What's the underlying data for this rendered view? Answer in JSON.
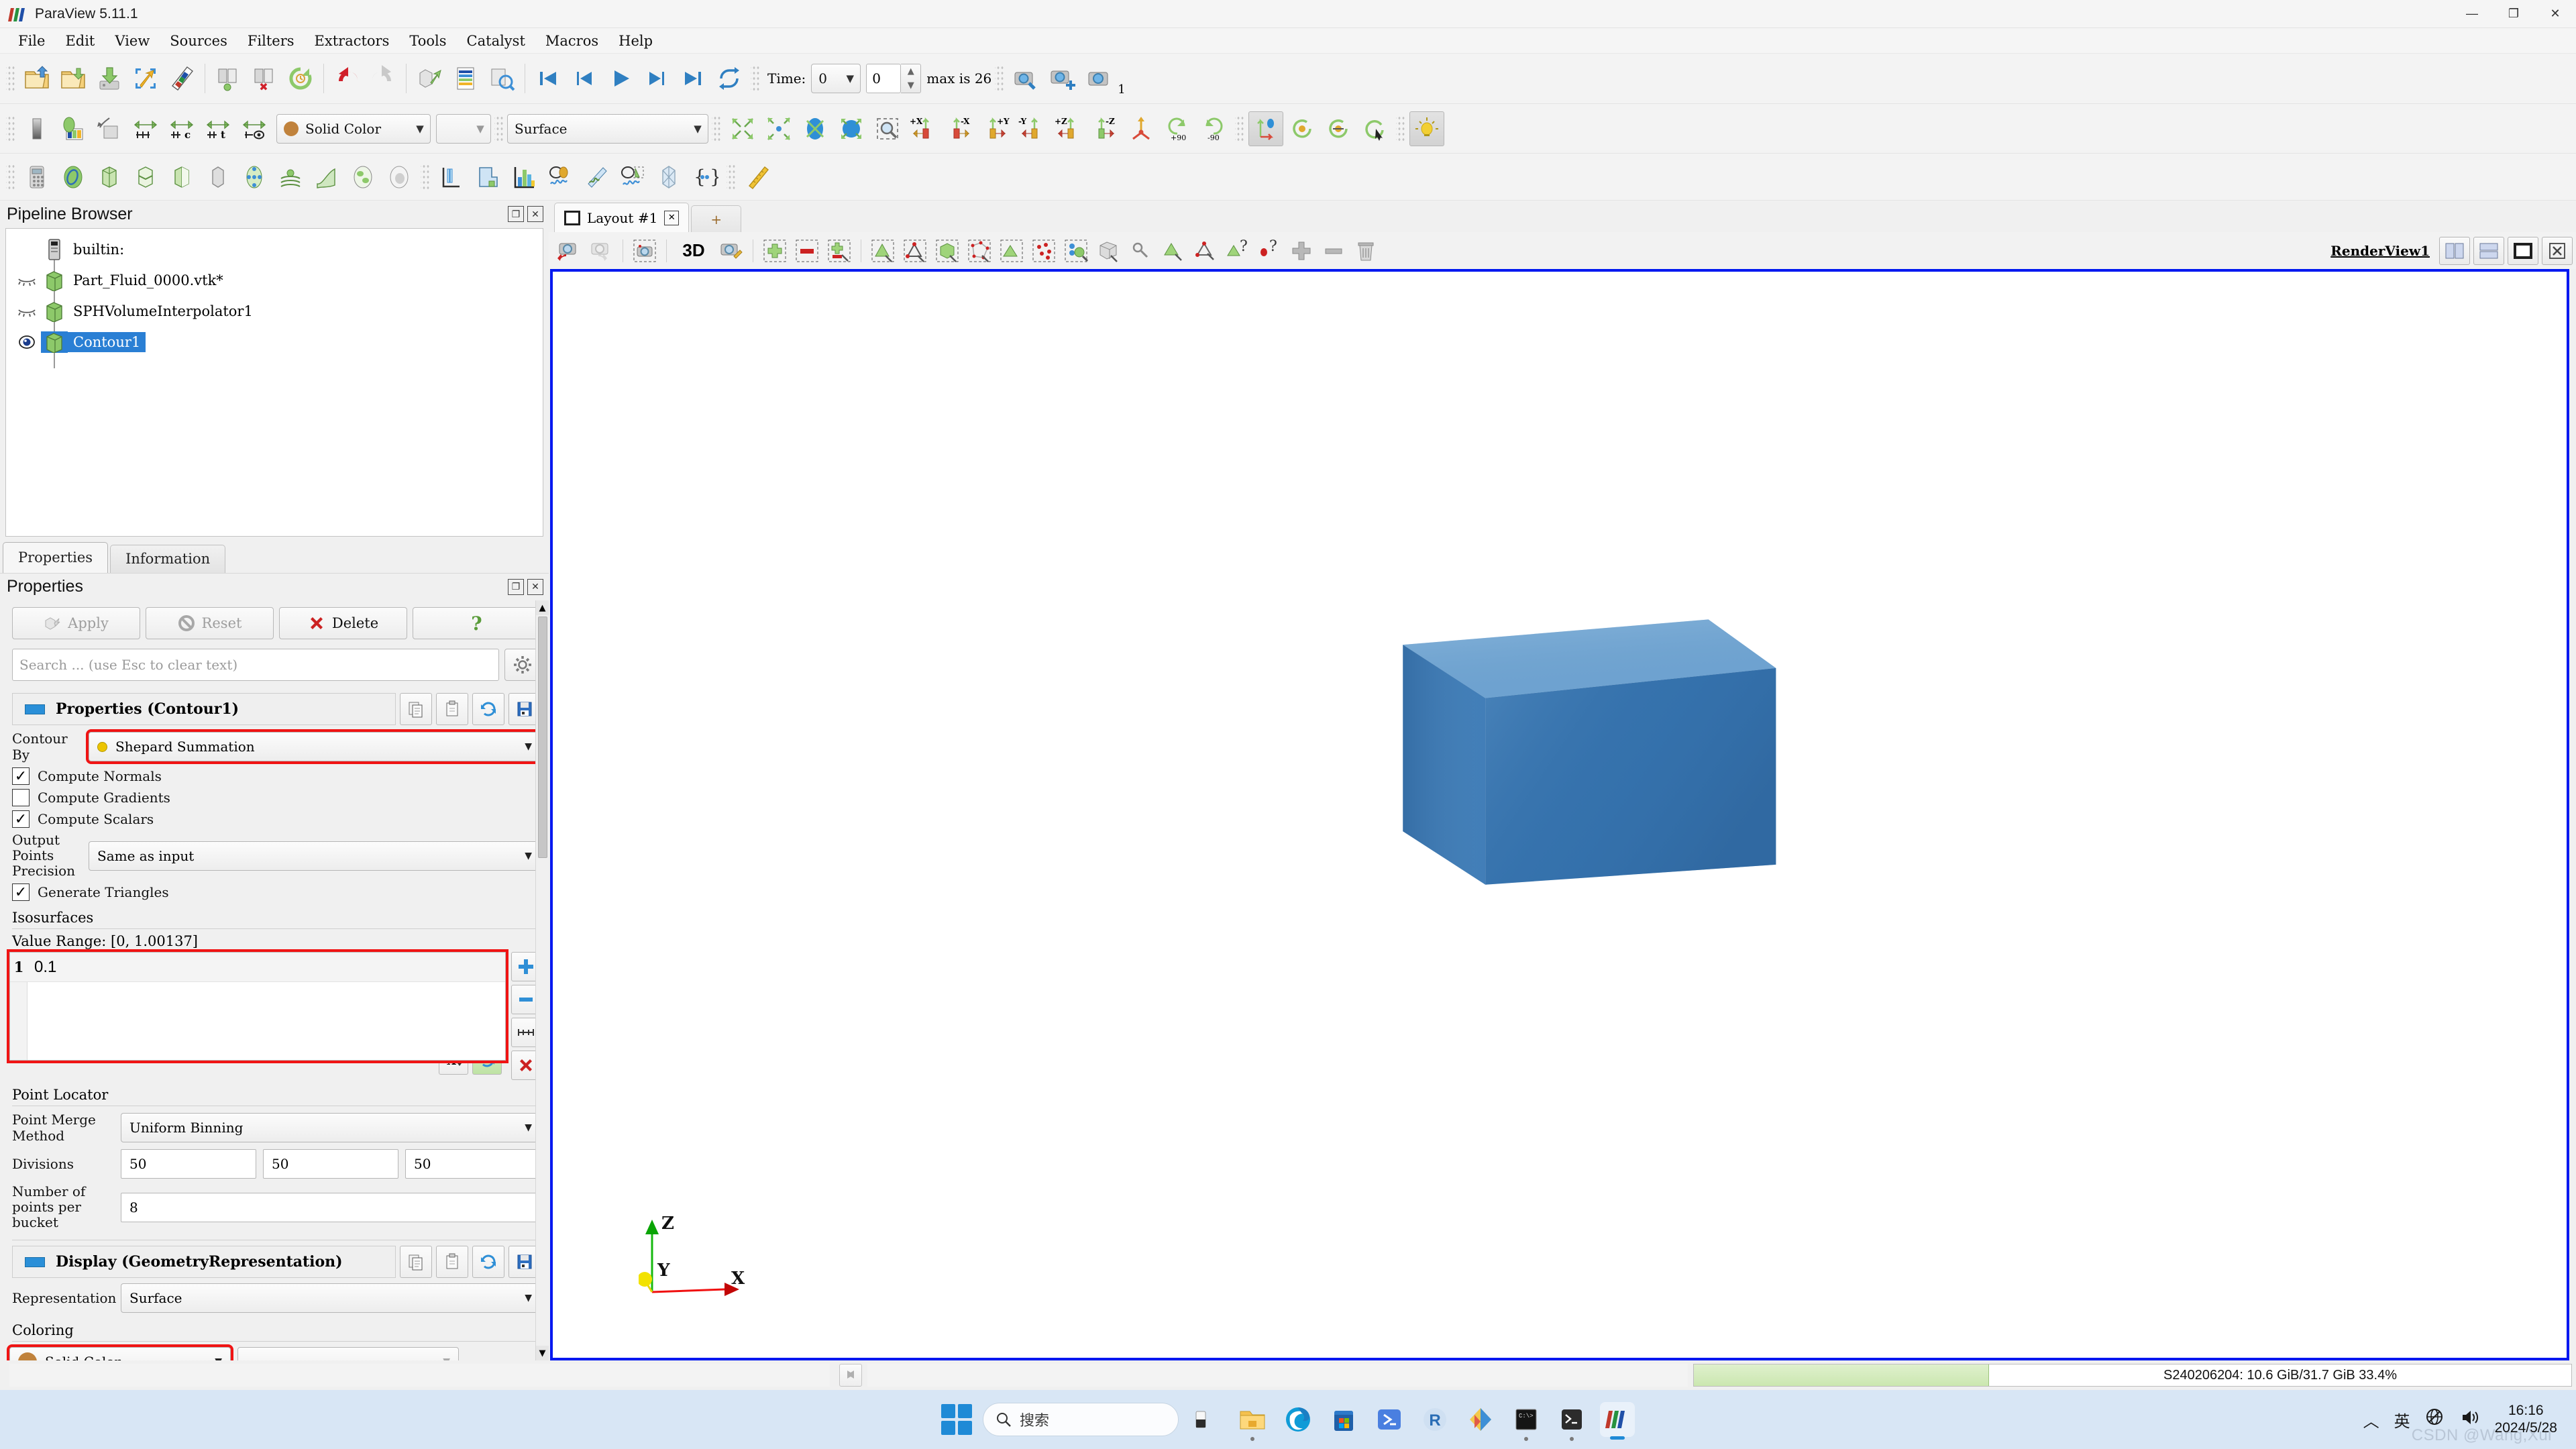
{
  "window": {
    "title": "ParaView 5.11.1",
    "minimize": "—",
    "maximize": "❐",
    "close": "✕"
  },
  "menu": {
    "items": [
      {
        "label": "File"
      },
      {
        "label": "Edit"
      },
      {
        "label": "View"
      },
      {
        "label": "Sources"
      },
      {
        "label": "Filters"
      },
      {
        "label": "Extractors"
      },
      {
        "label": "Tools"
      },
      {
        "label": "Catalyst"
      },
      {
        "label": "Macros"
      },
      {
        "label": "Help"
      }
    ]
  },
  "toolbar_main": {
    "time_label": "Time:",
    "time_value": "0",
    "frame_value": "0",
    "max_label": "max is 26",
    "screenshot_count": "1"
  },
  "toolbar_display": {
    "color_by": "Solid Color",
    "color_by_secondary": "",
    "representation": "Surface"
  },
  "pipeline": {
    "title": "Pipeline Browser",
    "items": [
      {
        "label": "builtin:",
        "type": "server",
        "visible": null,
        "selected": false
      },
      {
        "label": "Part_Fluid_0000.vtk*",
        "type": "source",
        "visible": false,
        "selected": false
      },
      {
        "label": "SPHVolumeInterpolator1",
        "type": "source",
        "visible": false,
        "selected": false
      },
      {
        "label": "Contour1",
        "type": "source",
        "visible": true,
        "selected": true
      }
    ]
  },
  "tabs": {
    "properties": "Properties",
    "information": "Information"
  },
  "properties": {
    "title": "Properties",
    "apply_label": "Apply",
    "reset_label": "Reset",
    "delete_label": "Delete",
    "help_label": "?",
    "search_placeholder": "Search ... (use Esc to clear text)",
    "section_properties": "Properties (Contour1)",
    "contour_by_label": "Contour By",
    "contour_by_value": "Shepard Summation",
    "compute_normals": {
      "label": "Compute Normals",
      "checked": true
    },
    "compute_gradients": {
      "label": "Compute Gradients",
      "checked": false
    },
    "compute_scalars": {
      "label": "Compute Scalars",
      "checked": true
    },
    "output_points_precision_label": "Output Points Precision",
    "output_points_precision_value": "Same as input",
    "generate_triangles": {
      "label": "Generate Triangles",
      "checked": true
    },
    "isosurfaces_label": "Isosurfaces",
    "value_range_label": "Value Range: [0, 1.00137]",
    "isosurface_rows": [
      {
        "index": "1",
        "value": "0.1"
      }
    ],
    "point_locator_label": "Point Locator",
    "point_merge_method_label": "Point Merge Method",
    "point_merge_method_value": "Uniform Binning",
    "divisions_label": "Divisions",
    "divisions": [
      "50",
      "50",
      "50"
    ],
    "points_per_bucket_label": "Number of points per bucket",
    "points_per_bucket_value": "8",
    "section_display": "Display (GeometryRepresentation)",
    "representation_label": "Representation",
    "representation_value": "Surface",
    "coloring_label": "Coloring",
    "coloring_value": "Solid Color",
    "coloring_secondary": ""
  },
  "layout": {
    "tab_label": "Layout #1",
    "tab_close": "✕",
    "new_tab": "+",
    "mode_3d": "3D",
    "view_name": "RenderView1"
  },
  "render": {
    "axis_x": "X",
    "axis_y": "Y",
    "axis_z": "Z",
    "box_color_top": "#5a92c8",
    "box_color_front": "#3b74b4",
    "box_color_side": "#2f66a4"
  },
  "statusbar": {
    "message": "",
    "memory": "S240206204: 10.6 GiB/31.7 GiB 33.4%",
    "memory_percent": 33.4
  },
  "taskbar": {
    "search_placeholder": "搜索",
    "tray_chevron": "︿",
    "tray_ime": "英",
    "time": "16:16",
    "date": "2024/5/28",
    "watermark": "CSDN @Wang,Xui"
  },
  "colors": {
    "accent_blue": "#2a7fd4",
    "highlight_red": "#f01414",
    "view_border": "#0018f0",
    "solid_color_swatch": "#c0823c",
    "array_dot": "#ecc400"
  }
}
